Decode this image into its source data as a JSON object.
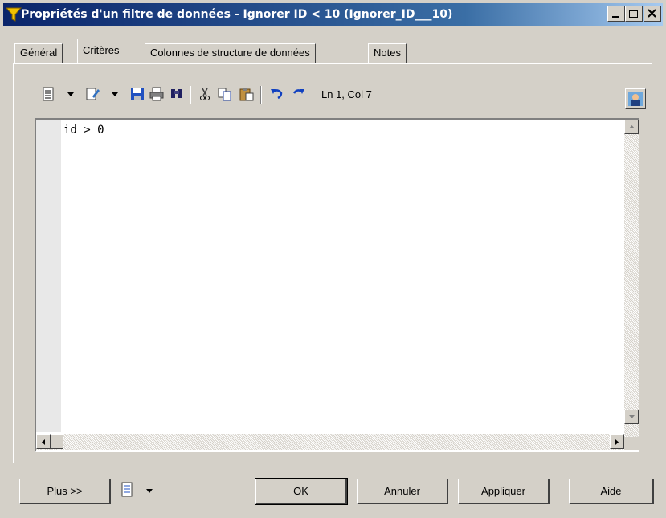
{
  "window": {
    "title": "Propriétés d'un filtre de données - Ignorer ID < 10 (Ignorer_ID___10)",
    "icon": "filter-icon"
  },
  "tabs": [
    {
      "label": "Général",
      "active": false
    },
    {
      "label": "Critères",
      "active": true
    },
    {
      "label": "Colonnes de structure de données",
      "active": false
    },
    {
      "label": "Notes",
      "active": false
    }
  ],
  "toolbar": {
    "icons": [
      "list-icon",
      "edit-icon",
      "save-icon",
      "print-icon",
      "find-icon",
      "cut-icon",
      "copy-icon",
      "paste-icon",
      "undo-icon",
      "redo-icon",
      "user-icon"
    ],
    "cursor_position": "Ln 1, Col 7"
  },
  "editor": {
    "lines": [
      "id > 0"
    ]
  },
  "buttons": {
    "more": "Plus >>",
    "ok": "OK",
    "cancel": "Annuler",
    "apply_prefix": "A",
    "apply_rest": "ppliquer",
    "help": "Aide"
  },
  "colors": {
    "titlebar_start": "#0a246a",
    "titlebar_end": "#a6caf0",
    "face": "#d4d0c8"
  }
}
